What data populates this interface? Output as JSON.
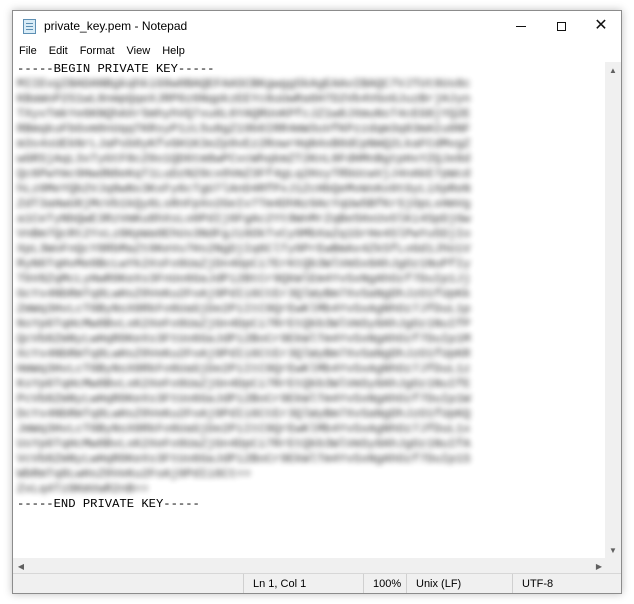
{
  "window": {
    "title": "private_key.pem - Notepad"
  },
  "menu": {
    "items": [
      "File",
      "Edit",
      "Format",
      "View",
      "Help"
    ]
  },
  "editor": {
    "begin_line": "-----BEGIN PRIVATE KEY-----",
    "end_line": "-----END PRIVATE KEY-----",
    "blurred_lines": [
      "MIIEvgIBADANBgkqhkiG9w0BAQEFAASCBKgwggSkAgEAAoIBAQC7VJTUt9Us8c",
      "KBaWoP2S1wL8nmpQqeXJRP0z6NqpkzEEYc8uUwRa6H7D2Vb4VGoGJuzBrjHJyn",
      "TXyvTmkYe6KNQhAXr5mhyhVQ7xu6L6YAQRUoKPfcJZ1w8JXmuNsT4cEG8jYQ2E",
      "RBmqkuFbGvm0nUqqTKRsyP1zL5u8gZ19b6IRR4mW3uVfKPzzdqm3q83mAIu0NF",
      "m3s4sUEkNrLJaPsb0yKfvGH1K3eZp9vEz2RowrHqN4xB0dCpNmQ2LkaFCdMvgZ",
      "wGRSjAqL3xTyGtF8cZ0o1QD6tm8wPCvcWhqkmZT2KnL8FdHMnBgtpHxYZQJe8d",
      "Qc6PwYmc9HwdN8eKqT1LuDzN29cx0VmZ3Ff4gLq2HsyTRbUcwVjJ4nAkE7pWcd",
      "hLz0MeYQb2VJq8wNs3KxFy6cTgU7lAnD4RfPxJ1ZcHbQeMvWsKo9tGyLiXpReN",
      "ZdT3aHwU8jMcVb1kQy6LsRnFpXo2GeIv7Tm4DhNz9AcYqUw5BfKrSjOpLxHmVg",
      "a1CeTyNbQwE3RzVmKu8hXsLo0PdIj6FgAc2Yt9WnMrZqBe5HxUvOlKi4SpDjGw",
      "VnBm7QcRt2YxLz8KpWa0EhUs3NdFgJi6OkTvCy9MbXaZq1GrHe4SlPwYu5DjIo",
      "XpL3WoFnQcY8RbMaZt0KeVu7Hs2NgDjIq6ClTy9PrEwBmAx4ZkSfLoGd1JhUiV",
      "RyN6TqHvMe0BcLwYk2XsFo9UaZjDn4GpCi7ErKtQb3WlVmSx8AhJgOz1NuPfIy",
      "TbV8ZqMcLyHwR0KeXs3FnUo6GaJdPi2BtCr9QkWlEm4YvSxNgAhOzf7DuIp1Jj",
      "GcYx4NbRmTq8LwHsZ0VeKu2FoAj9PdIi6CtEr3QlWyBm7XvSaNgDhJzO1fUpKk",
      "ZmWq3HvLcT0ByNsX8RkFo6UaGjDe2PiItC9QrEwKlMb4YvSxAgNhOz7JfDuL1p",
      "NsYp6TqHcMw0BvLxK2XeFo9UaZjGn4DpCi7RrEtQkb3WlVmSy8AhJgOz1NuIfP",
      "QcVb8ZmNyLwHqR0KeXs3FtUo6GaJdPi2BoCr9EkWlTm4YvSxNgAhOzf7DuIp1M",
      "XcYx4NbRmTq8LwHsZ0VeKu2FoAj9PdIi6CtEr3QlWyBm7XvSaNgDhJzO1fUpKR",
      "HmWq3HvLcT0ByNsX8RkFo6UaGjDe2PiItC9QrEwKlMb4YvSxAgNhOz7JfDuL1z",
      "KsYp6TqHcMw0BvLxK2XeFo9UaZjGn4DpCi7RrEtQkb3WlVmSy8AhJgOz1NuIfE",
      "PcVb8ZmNyLwHqR0KeXs3FtUo6GaJdPi2BoCr9EkWlTm4YvSxNgAhOzf7DuIp1W",
      "DcYx4NbRmTq8LwHsZ0VeKu2FoAj9PdIi6CtEr3QlWyBm7XvSaNgDhJzO1fUpKQ",
      "JmWq3HvLcT0ByNsX8RkFo6UaGjDe2PiItC9QrEwKlMb4YvSxAgNhOz7JfDuL1x",
      "UsYp6TqHcMw0BvLxK2XeFo9UaZjGn4DpCi7RrEtQkb3WlVmSy8AhJgOz1NuIfA",
      "VcVb8ZmNyLwHqR0KeXs3FtUo6GaJdPi2BoCr9EkWlTm4YvSxNgAhOzf7DuIp1S",
      "WbRmTq8LwHsZ0VeKu2FoAj9PdIi6Ct==",
      "ZxLq4Tz8KmVwR2nB=="
    ]
  },
  "status": {
    "position": "Ln 1, Col 1",
    "zoom": "100%",
    "line_ending": "Unix (LF)",
    "encoding": "UTF-8"
  }
}
